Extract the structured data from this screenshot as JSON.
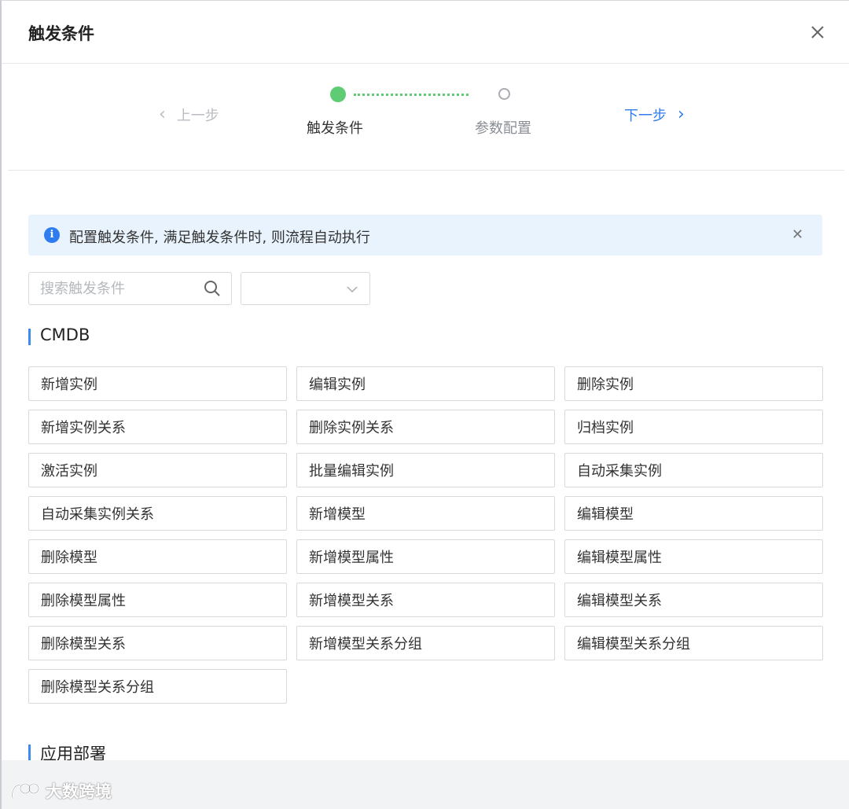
{
  "dialog": {
    "title": "触发条件"
  },
  "steps": {
    "prev_label": "上一步",
    "next_label": "下一步",
    "items": [
      {
        "label": "触发条件",
        "status": "active",
        "color": "#5fcb74"
      },
      {
        "label": "参数配置",
        "status": "inactive"
      }
    ]
  },
  "alert": {
    "text": "配置触发条件, 满足触发条件时, 则流程自动执行"
  },
  "filter": {
    "search_placeholder": "搜索触发条件",
    "select_value": ""
  },
  "sections": [
    {
      "title": "CMDB",
      "items": [
        "新增实例",
        "编辑实例",
        "删除实例",
        "新增实例关系",
        "删除实例关系",
        "归档实例",
        "激活实例",
        "批量编辑实例",
        "自动采集实例",
        "自动采集实例关系",
        "新增模型",
        "编辑模型",
        "删除模型",
        "新增模型属性",
        "编辑模型属性",
        "删除模型属性",
        "新增模型关系",
        "编辑模型关系",
        "删除模型关系",
        "新增模型关系分组",
        "编辑模型关系分组",
        "删除模型关系分组"
      ]
    },
    {
      "title": "应用部署",
      "items": []
    }
  ],
  "watermark": {
    "text": "大数跨境"
  },
  "colors": {
    "accent": "#2f7cf0",
    "success": "#5fcb74",
    "alert_bg": "#e9f3fd"
  }
}
